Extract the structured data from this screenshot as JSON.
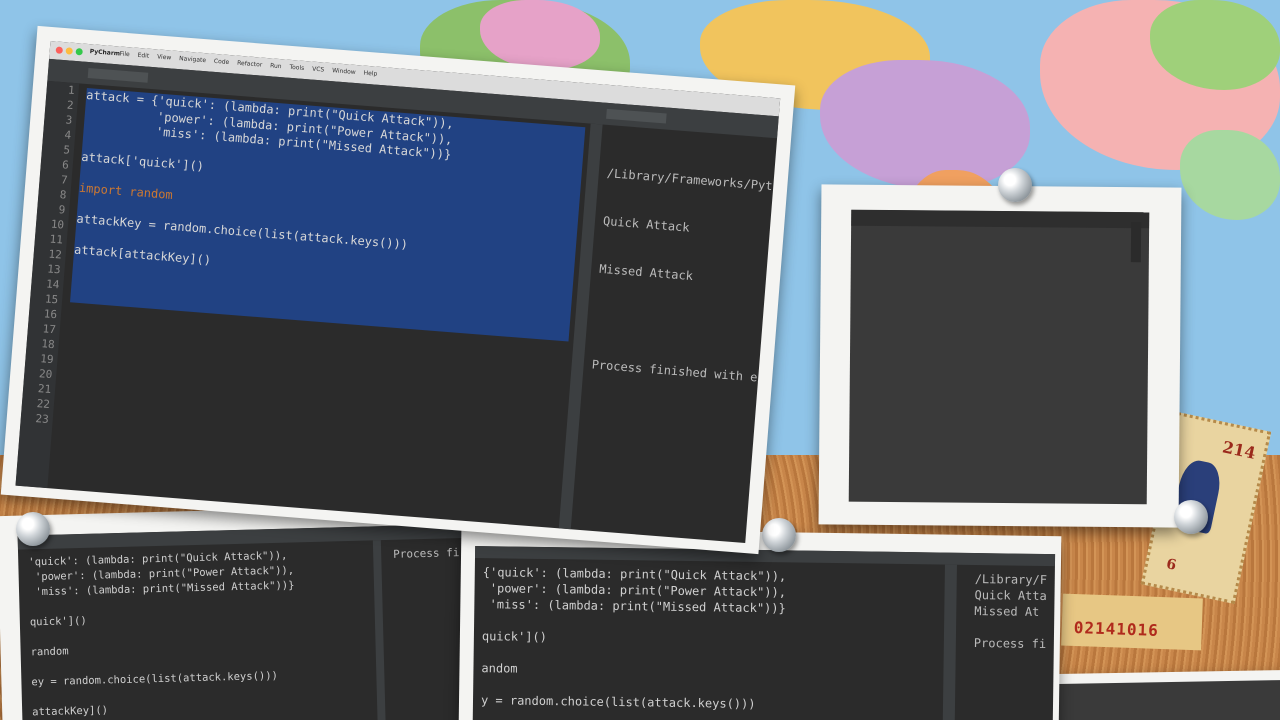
{
  "ide_main": {
    "app_name": "PyCharm",
    "menu": [
      "File",
      "Edit",
      "View",
      "Navigate",
      "Code",
      "Refactor",
      "Run",
      "Tools",
      "VCS",
      "Window",
      "Help"
    ],
    "line_numbers": [
      "1",
      "2",
      "3",
      "4",
      "5",
      "6",
      "7",
      "8",
      "9",
      "10",
      "11",
      "12",
      "13",
      "14",
      "15",
      "16",
      "17",
      "18",
      "19",
      "20",
      "21",
      "22",
      "23"
    ],
    "code_lines": [
      "attack = {'quick': (lambda: print(\"Quick Attack\")),",
      "          'power': (lambda: print(\"Power Attack\")),",
      "          'miss': (lambda: print(\"Missed Attack\"))}",
      "",
      "attack['quick']()",
      "",
      "import random",
      "",
      "attackKey = random.choice(list(attack.keys()))",
      "",
      "attack[attackKey]()"
    ],
    "console_lines": [
      "/Library/Frameworks/Pyth",
      "Quick Attack",
      "Missed Attack",
      "",
      "Process finished with ex"
    ]
  },
  "card_bottom_left": {
    "code_lines": [
      "'quick': (lambda: print(\"Quick Attack\")),",
      " 'power': (lambda: print(\"Power Attack\")),",
      " 'miss': (lambda: print(\"Missed Attack\"))}",
      "",
      "quick']()",
      "",
      "random",
      "",
      "ey = random.choice(list(attack.keys()))",
      "",
      "attackKey]()"
    ],
    "console_text": "Process fi"
  },
  "card_bottom_middle": {
    "code_lines": [
      "{'quick': (lambda: print(\"Quick Attack\")),",
      " 'power': (lambda: print(\"Power Attack\")),",
      " 'miss': (lambda: print(\"Missed Attack\"))}",
      "",
      "quick']()",
      "",
      "andom",
      "",
      "y = random.choice(list(attack.keys()))"
    ],
    "console_lines": [
      "/Library/F",
      "Quick Atta",
      "Missed At",
      "",
      "Process fi"
    ]
  },
  "ticket_number": "02141016",
  "stamp_value": "214",
  "stamp_value_2": "6"
}
